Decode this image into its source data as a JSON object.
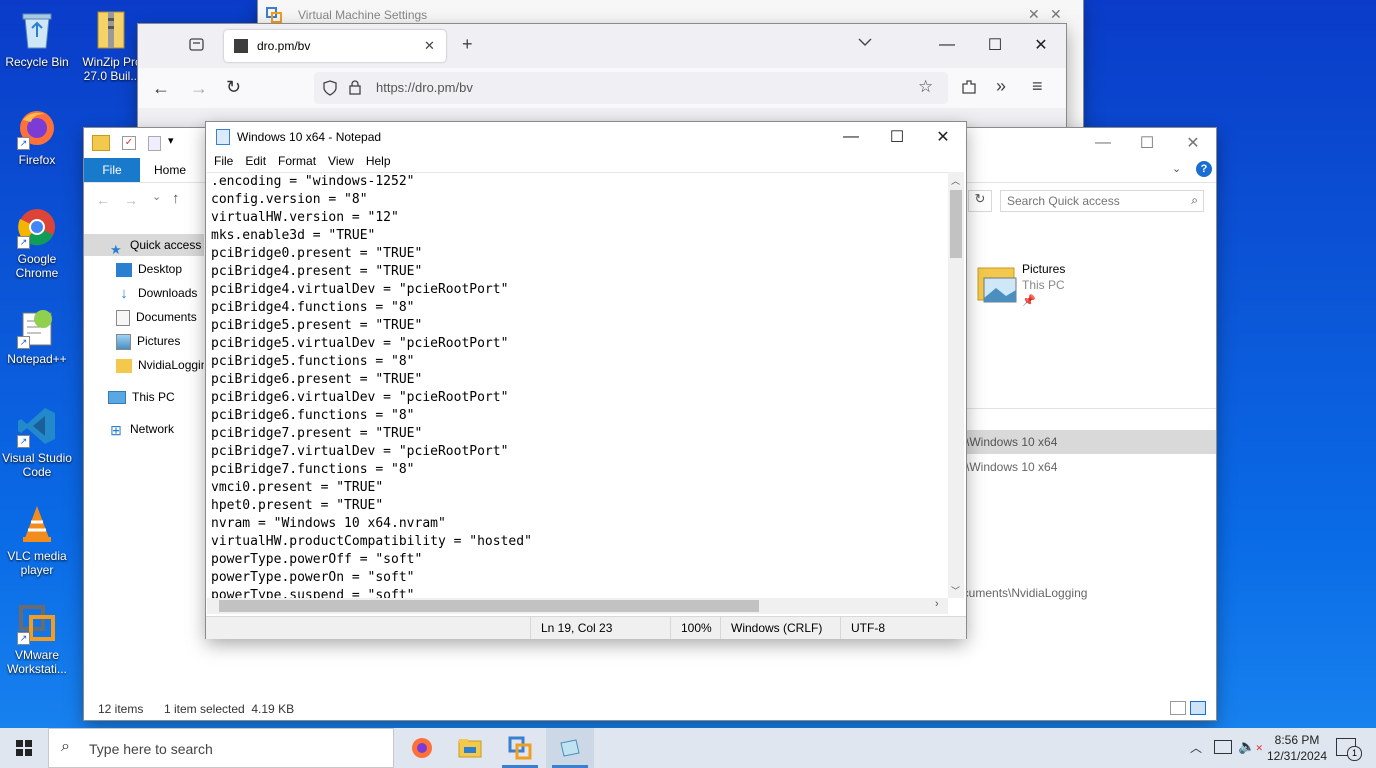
{
  "desktop": {
    "icons": [
      {
        "label": "Recycle Bin"
      },
      {
        "label": "WinZip Pro 27.0 Buil..."
      },
      {
        "label": "Firefox"
      },
      {
        "label": "Google Chrome"
      },
      {
        "label": "Notepad++"
      },
      {
        "label": "Visual Studio Code"
      },
      {
        "label": "VLC media player"
      },
      {
        "label": "VMware Workstati..."
      }
    ]
  },
  "vm_settings": {
    "title": "Virtual Machine Settings",
    "close": "✕"
  },
  "browser": {
    "tab_title": "dro.pm/bv",
    "url": "https://dro.pm/bv",
    "new_tab": "+",
    "tab_close": "✕"
  },
  "explorer": {
    "ribbon_tabs": [
      "File",
      "Home"
    ],
    "search_placeholder": "Search Quick access",
    "nav": [
      {
        "label": "Quick access",
        "icon": "star-icon"
      },
      {
        "label": "Desktop",
        "icon": "desktop-folder-icon"
      },
      {
        "label": "Downloads",
        "icon": "download-icon"
      },
      {
        "label": "Documents",
        "icon": "documents-icon"
      },
      {
        "label": "Pictures",
        "icon": "pictures-icon"
      },
      {
        "label": "NvidiaLogging",
        "icon": "folder-icon"
      },
      {
        "label": "This PC",
        "icon": "computer-icon"
      },
      {
        "label": "Network",
        "icon": "network-icon"
      }
    ],
    "pictures_tile": {
      "name": "Pictures",
      "location": "This PC"
    },
    "recent_paths": [
      "\\Windows 10 x64",
      "\\Windows 10 x64",
      "ocuments\\NvidiaLogging"
    ],
    "status_items": "12 items",
    "status_selected": "1 item selected  4.19 KB"
  },
  "notepad": {
    "title": "Windows 10 x64 - Notepad",
    "menu": [
      "File",
      "Edit",
      "Format",
      "View",
      "Help"
    ],
    "lines": [
      ".encoding = \"windows-1252\"",
      "config.version = \"8\"",
      "virtualHW.version = \"12\"",
      "mks.enable3d = \"TRUE\"",
      "pciBridge0.present = \"TRUE\"",
      "pciBridge4.present = \"TRUE\"",
      "pciBridge4.virtualDev = \"pcieRootPort\"",
      "pciBridge4.functions = \"8\"",
      "pciBridge5.present = \"TRUE\"",
      "pciBridge5.virtualDev = \"pcieRootPort\"",
      "pciBridge5.functions = \"8\"",
      "pciBridge6.present = \"TRUE\"",
      "pciBridge6.virtualDev = \"pcieRootPort\"",
      "pciBridge6.functions = \"8\"",
      "pciBridge7.present = \"TRUE\"",
      "pciBridge7.virtualDev = \"pcieRootPort\"",
      "pciBridge7.functions = \"8\"",
      "vmci0.present = \"TRUE\"",
      "hpet0.present = \"TRUE\"",
      "nvram = \"Windows 10 x64.nvram\"",
      "virtualHW.productCompatibility = \"hosted\"",
      "powerType.powerOff = \"soft\"",
      "powerType.powerOn = \"soft\"",
      "powerType.suspend = \"soft\""
    ],
    "status": {
      "position": "Ln 19, Col 23",
      "zoom": "100%",
      "line_ending": "Windows (CRLF)",
      "encoding": "UTF-8"
    }
  },
  "taskbar": {
    "search_placeholder": "Type here to search",
    "time": "8:56 PM",
    "date": "12/31/2024",
    "notification_count": "1"
  },
  "colors": {
    "accent": "#0078d7",
    "explorer_file_tab": "#1979ca",
    "taskbar": "#dfe6ef"
  }
}
